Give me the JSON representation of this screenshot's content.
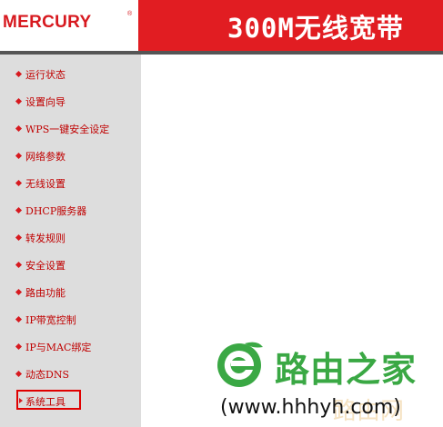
{
  "header": {
    "logo": "MERCURY",
    "logo_mark": "®",
    "title": "300M无线宽带"
  },
  "colors": {
    "brand_red": "#e11d22",
    "menu_text": "#c00000",
    "sidebar_bg": "#dddddd",
    "watermark_green": "#3aa844"
  },
  "sidebar": {
    "items": [
      {
        "label": "运行状态"
      },
      {
        "label": "设置向导"
      },
      {
        "label": "WPS一键安全设定"
      },
      {
        "label": "网络参数"
      },
      {
        "label": "无线设置"
      },
      {
        "label": "DHCP服务器"
      },
      {
        "label": "转发规则"
      },
      {
        "label": "安全设置"
      },
      {
        "label": "路由功能"
      },
      {
        "label": "IP带宽控制"
      },
      {
        "label": "IP与MAC绑定"
      },
      {
        "label": "动态DNS"
      },
      {
        "label": "系统工具"
      }
    ],
    "selected": "系统工具"
  },
  "watermark": {
    "icon": "leaf-e-logo-icon",
    "brand": "路由之家",
    "url": "(www.hhhyh.com)",
    "faint": "路由网"
  }
}
